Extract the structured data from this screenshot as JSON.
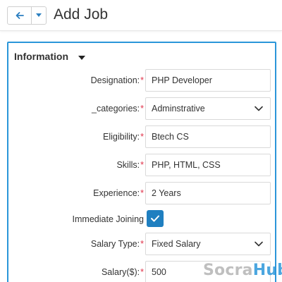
{
  "header": {
    "back_icon": "arrow-left-icon",
    "dropdown_icon": "caret-down-icon",
    "title": "Add Job"
  },
  "section": {
    "title": "Information",
    "toggle_icon": "caret-down-icon"
  },
  "form": {
    "designation": {
      "label": "Designation:",
      "required": "*",
      "value": "PHP Developer"
    },
    "categories": {
      "label": "_categories:",
      "required": "*",
      "value": "Adminstrative"
    },
    "eligibility": {
      "label": "Eligibility:",
      "required": "*",
      "value": "Btech CS"
    },
    "skills": {
      "label": "Skills:",
      "required": "*",
      "value": "PHP, HTML, CSS"
    },
    "experience": {
      "label": "Experience:",
      "required": "*",
      "value": "2 Years"
    },
    "immediate_joining": {
      "label": "Immediate Joining",
      "checked": true
    },
    "salary_type": {
      "label": "Salary Type:",
      "required": "*",
      "value": "Fixed Salary"
    },
    "salary": {
      "label": "Salary($):",
      "required": "*",
      "value": "500"
    }
  },
  "watermark": {
    "part1": "Socra",
    "part2": "Hub"
  },
  "colors": {
    "accent": "#2b96d9",
    "required": "#e0334a",
    "checkbox": "#1f7fc0"
  }
}
